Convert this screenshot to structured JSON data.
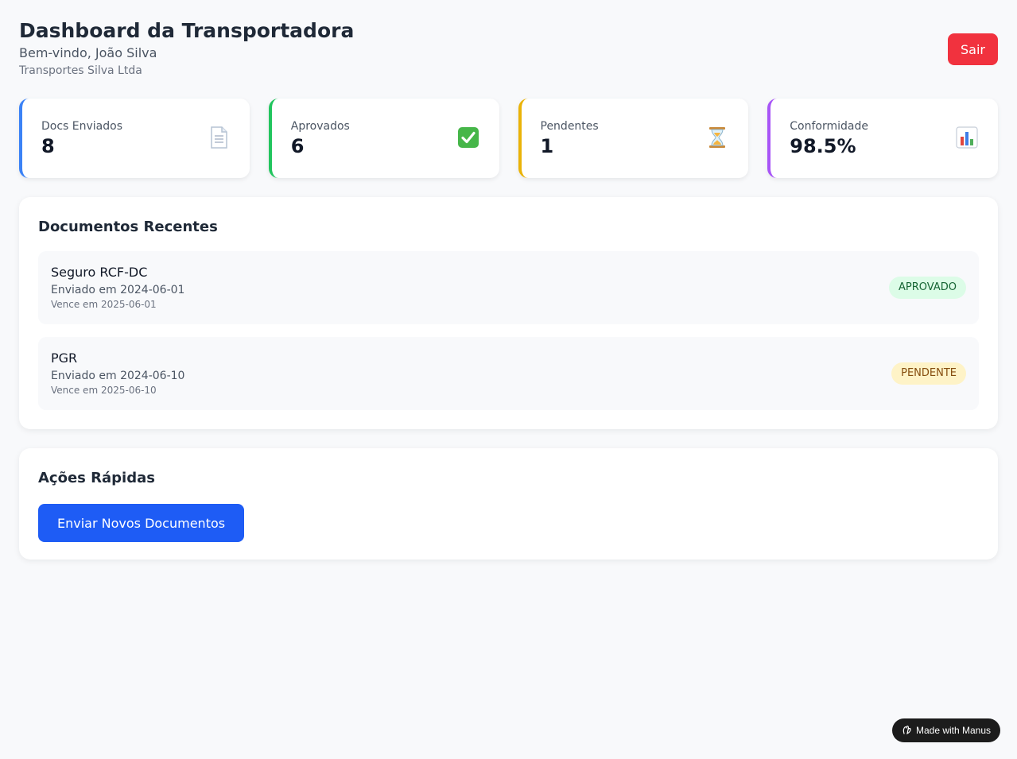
{
  "header": {
    "title": "Dashboard da Transportadora",
    "welcome": "Bem-vindo, João Silva",
    "company": "Transportes Silva Ltda",
    "logout_label": "Sair"
  },
  "stats": [
    {
      "label": "Docs Enviados",
      "value": "8",
      "icon": "document-icon",
      "color": "#3b82f6"
    },
    {
      "label": "Aprovados",
      "value": "6",
      "icon": "check-icon",
      "color": "#22c55e"
    },
    {
      "label": "Pendentes",
      "value": "1",
      "icon": "hourglass-icon",
      "color": "#eab308"
    },
    {
      "label": "Conformidade",
      "value": "98.5%",
      "icon": "bar-chart-icon",
      "color": "#a855f7"
    }
  ],
  "recent": {
    "title": "Documentos Recentes",
    "documents": [
      {
        "name": "Seguro RCF-DC",
        "sent": "Enviado em 2024-06-01",
        "due": "Vence em 2025-06-01",
        "status": "APROVADO"
      },
      {
        "name": "PGR",
        "sent": "Enviado em 2024-06-10",
        "due": "Vence em 2025-06-10",
        "status": "PENDENTE"
      }
    ]
  },
  "actions": {
    "title": "Ações Rápidas",
    "send_label": "Enviar Novos Documentos"
  },
  "footer": {
    "badge_label": "Made with Manus"
  },
  "colors": {
    "logout": "#f1323e",
    "primary": "#1e5cf5",
    "approved_bg": "#dcfce7",
    "pending_bg": "#fef3c7"
  }
}
